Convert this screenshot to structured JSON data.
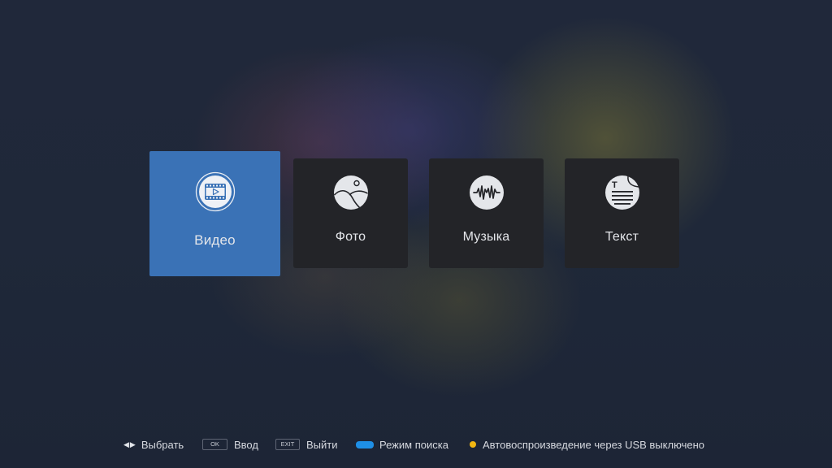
{
  "menu": {
    "items": [
      {
        "label": "Видео",
        "icon": "video-play-icon",
        "selected": true
      },
      {
        "label": "Фото",
        "icon": "photo-landscape-icon",
        "selected": false
      },
      {
        "label": "Музыка",
        "icon": "music-waveform-icon",
        "selected": false
      },
      {
        "label": "Текст",
        "icon": "text-document-icon",
        "selected": false
      }
    ]
  },
  "hints": {
    "select_label": "Выбрать",
    "ok_key": "OK",
    "enter_label": "Ввод",
    "exit_key": "EXIT",
    "exit_label": "Выйти",
    "search_mode_label": "Режим поиска",
    "autoplay_label": "Автовоспроизведение через USB выключено"
  },
  "colors": {
    "accent": "#3a72b6",
    "tile": "#232428",
    "blue_key": "#1e8fe6",
    "yellow_key": "#f1b612"
  }
}
